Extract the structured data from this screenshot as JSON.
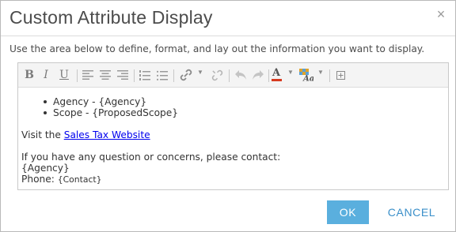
{
  "dialog": {
    "title": "Custom Attribute Display",
    "close_symbol": "×",
    "instructions": "Use the area below to define, format, and lay out the information you want to display."
  },
  "toolbar": {
    "bold": "B",
    "italic": "I",
    "underline": "U",
    "text_color_glyph": "A",
    "icons": [
      "bold-icon",
      "italic-icon",
      "underline-icon",
      "align-left-icon",
      "align-center-icon",
      "align-right-icon",
      "ordered-list-icon",
      "unordered-list-icon",
      "link-icon",
      "unlink-icon",
      "undo-icon",
      "redo-icon",
      "text-color-icon",
      "highlight-color-icon",
      "insert-field-icon"
    ]
  },
  "content": {
    "bullets": [
      "Agency - {Agency}",
      "Scope - {ProposedScope}"
    ],
    "visit_prefix": "Visit the ",
    "visit_link": "Sales Tax Website",
    "contact_intro": "If you have any question or concerns, please contact:",
    "contact_agency": "{Agency}",
    "phone_label": "Phone: ",
    "phone_field": "{Contact}"
  },
  "buttons": {
    "ok": "OK",
    "cancel": "CANCEL"
  },
  "colors": {
    "ok_bg": "#5aafde",
    "cancel_text": "#3a8fc9",
    "link": "#0000ee"
  }
}
